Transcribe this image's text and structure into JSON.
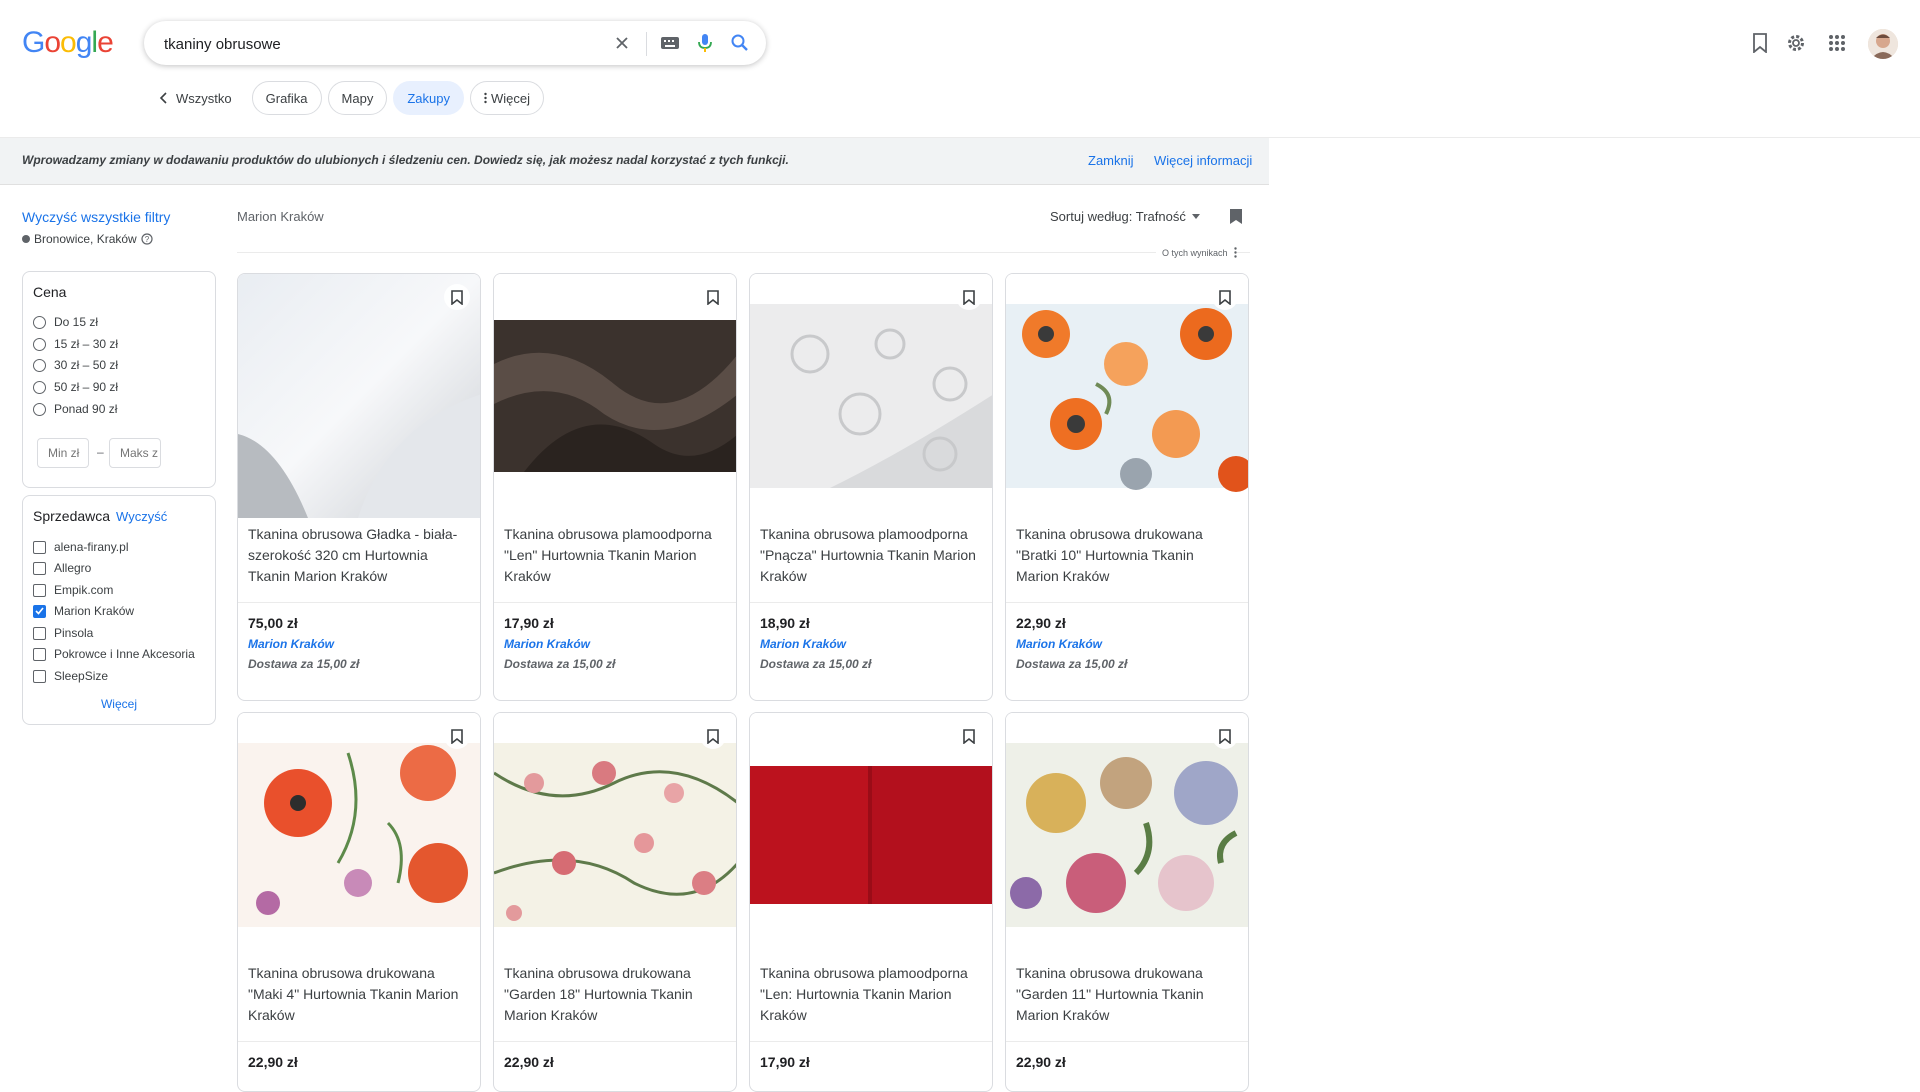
{
  "header": {
    "logo": [
      "G",
      "o",
      "o",
      "g",
      "l",
      "e"
    ],
    "logo_colors": [
      "#4285f4",
      "#ea4335",
      "#fbbc05",
      "#4285f4",
      "#34a853",
      "#ea4335"
    ],
    "search_value": "tkaniny obrusowe",
    "icons": [
      "close-icon",
      "keyboard-icon",
      "mic-icon",
      "search-icon",
      "bookmark-icon",
      "gear-icon",
      "apps-icon"
    ]
  },
  "tabs": {
    "back_label": "Wszystko",
    "chips": [
      "Grafika",
      "Mapy",
      "Zakupy",
      "Więcej"
    ],
    "active": "Zakupy"
  },
  "banner": {
    "text": "Wprowadzamy zmiany w dodawaniu produktów do ulubionych i śledzeniu cen. Dowiedz się, jak możesz nadal korzystać z tych funkcji.",
    "close_label": "Zamknij",
    "more_label": "Więcej informacji"
  },
  "sidebar": {
    "clear_all": "Wyczyść wszystkie filtry",
    "location": "Bronowice, Kraków",
    "price": {
      "title": "Cena",
      "options": [
        "Do 15 zł",
        "15 zł – 30 zł",
        "30 zł – 50 zł",
        "50 zł – 90 zł",
        "Ponad 90 zł"
      ],
      "min_placeholder": "Min zł",
      "max_placeholder": "Maks zł",
      "dash": "–"
    },
    "seller": {
      "title": "Sprzedawca",
      "clear": "Wyczyść",
      "options": [
        "alena-firany.pl",
        "Allegro",
        "Empik.com",
        "Marion Kraków",
        "Pinsola",
        "Pokrowce i Inne Akcesoria",
        "SleepSize"
      ],
      "checked": "Marion Kraków",
      "more": "Więcej"
    }
  },
  "results": {
    "filter_label": "Marion Kraków",
    "sort_label": "Sortuj według: Trafność",
    "about": "O tych wynikach"
  },
  "products": [
    {
      "title": "Tkanina obrusowa Gładka - biała- szerokość 320 cm Hurtownia Tkanin Marion Kraków",
      "price": "75,00 zł",
      "seller": "Marion Kraków",
      "shipping": "Dostawa za 15,00 zł"
    },
    {
      "title": "Tkanina obrusowa plamoodporna \"Len\" Hurtownia Tkanin Marion Kraków",
      "price": "17,90 zł",
      "seller": "Marion Kraków",
      "shipping": "Dostawa za 15,00 zł"
    },
    {
      "title": "Tkanina obrusowa plamoodporna \"Pnącza\" Hurtownia Tkanin Marion Kraków",
      "price": "18,90 zł",
      "seller": "Marion Kraków",
      "shipping": "Dostawa za 15,00 zł"
    },
    {
      "title": "Tkanina obrusowa drukowana \"Bratki 10\" Hurtownia Tkanin Marion Kraków",
      "price": "22,90 zł",
      "seller": "Marion Kraków",
      "shipping": "Dostawa za 15,00 zł"
    },
    {
      "title": "Tkanina obrusowa drukowana \"Maki 4\" Hurtownia Tkanin Marion Kraków",
      "price": "22,90 zł",
      "seller": "",
      "shipping": ""
    },
    {
      "title": "Tkanina obrusowa drukowana \"Garden 18\" Hurtownia Tkanin Marion Kraków",
      "price": "22,90 zł",
      "seller": "",
      "shipping": ""
    },
    {
      "title": "Tkanina obrusowa plamoodporna \"Len: Hurtownia Tkanin Marion Kraków",
      "price": "17,90 zł",
      "seller": "",
      "shipping": ""
    },
    {
      "title": "Tkanina obrusowa drukowana \"Garden 11\" Hurtownia Tkanin Marion Kraków",
      "price": "22,90 zł",
      "seller": "",
      "shipping": ""
    }
  ]
}
